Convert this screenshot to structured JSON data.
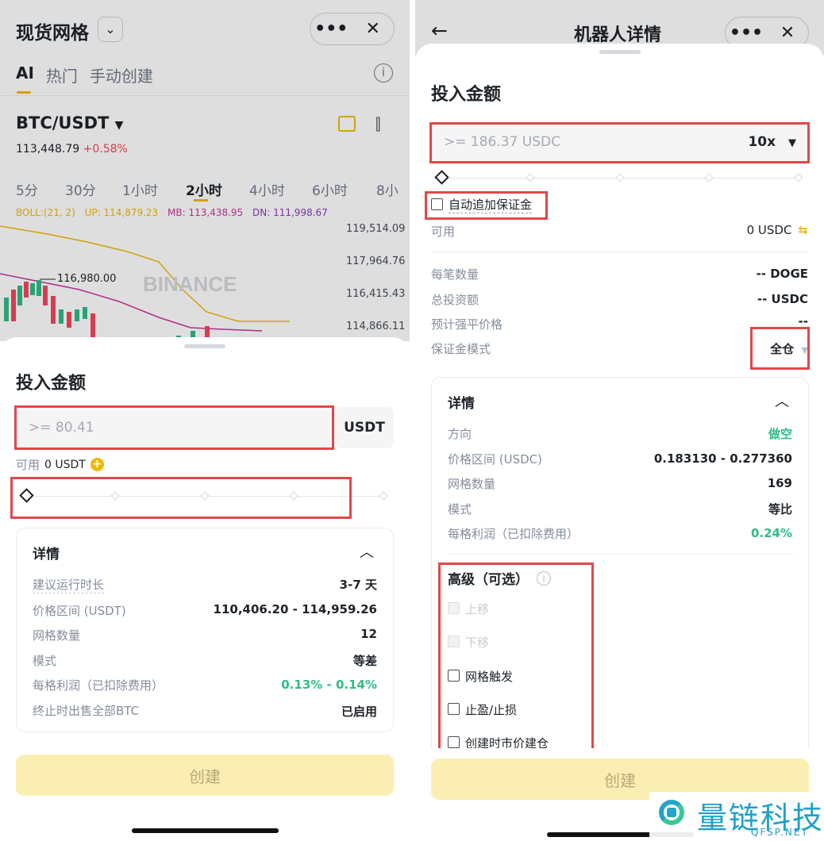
{
  "left": {
    "title": "现货网格",
    "tabs": [
      "AI",
      "热门",
      "手动创建"
    ],
    "pair": "BTC/USDT",
    "price": "113,448.79",
    "change": "+0.58%",
    "timeframes": [
      "5分",
      "30分",
      "1小时",
      "2小时",
      "4小时",
      "6小时",
      "8小"
    ],
    "boll": {
      "label": "BOLL:(21, 2)",
      "up": "UP: 114,879.23",
      "mb": "MB: 113,438.95",
      "dn": "DN: 111,998.67"
    },
    "yticks": [
      "119,514.09",
      "117,964.76",
      "116,415.43",
      "114,866.11"
    ],
    "peak_label": "116,980.00",
    "watermark": "BINANCE",
    "sheet": {
      "title": "投入金额",
      "amount_placeholder": ">= 80.41",
      "currency": "USDT",
      "avail_label": "可用",
      "avail_value": "0 USDT",
      "details_title": "详情",
      "rows": [
        {
          "label": "建议运行时长",
          "value": "3-7 天"
        },
        {
          "label": "价格区间 (USDT)",
          "value": "110,406.20 - 114,959.26"
        },
        {
          "label": "网格数量",
          "value": "12"
        },
        {
          "label": "模式",
          "value": "等差"
        },
        {
          "label": "每格利润（已扣除费用）",
          "value": "0.13% - 0.14%"
        },
        {
          "label": "终止时出售全部BTC",
          "value": "已启用"
        }
      ],
      "create": "创建"
    }
  },
  "right": {
    "title": "机器人详情",
    "sheet": {
      "title": "投入金额",
      "amount_placeholder": ">= 186.37 USDC",
      "leverage": "10x",
      "auto_margin": "自动追加保证金",
      "avail_label": "可用",
      "avail_value": "0 USDC",
      "rows": [
        {
          "label": "每笔数量",
          "value": "-- DOGE"
        },
        {
          "label": "总投资额",
          "value": "-- USDC"
        },
        {
          "label": "预计强平价格",
          "value": "--"
        },
        {
          "label": "保证金模式",
          "value": "全仓"
        }
      ],
      "details_title": "详情",
      "details": [
        {
          "label": "方向",
          "value": "做空"
        },
        {
          "label": "价格区间 (USDC)",
          "value": "0.183130 - 0.277360"
        },
        {
          "label": "网格数量",
          "value": "169"
        },
        {
          "label": "模式",
          "value": "等比"
        },
        {
          "label": "每格利润（已扣除费用）",
          "value": "0.24%"
        }
      ],
      "advanced_title": "高级（可选）",
      "advanced": [
        "上移",
        "下移",
        "网格触发",
        "止盈/止损",
        "创建时市价建仓"
      ],
      "create": "创建"
    }
  },
  "brand": {
    "name": "量链科技",
    "domain": "QFSP.NET"
  },
  "colors": {
    "accent": "#f0b90b",
    "red": "#e0484a",
    "green": "#2ebd85",
    "down": "#f6465d"
  }
}
